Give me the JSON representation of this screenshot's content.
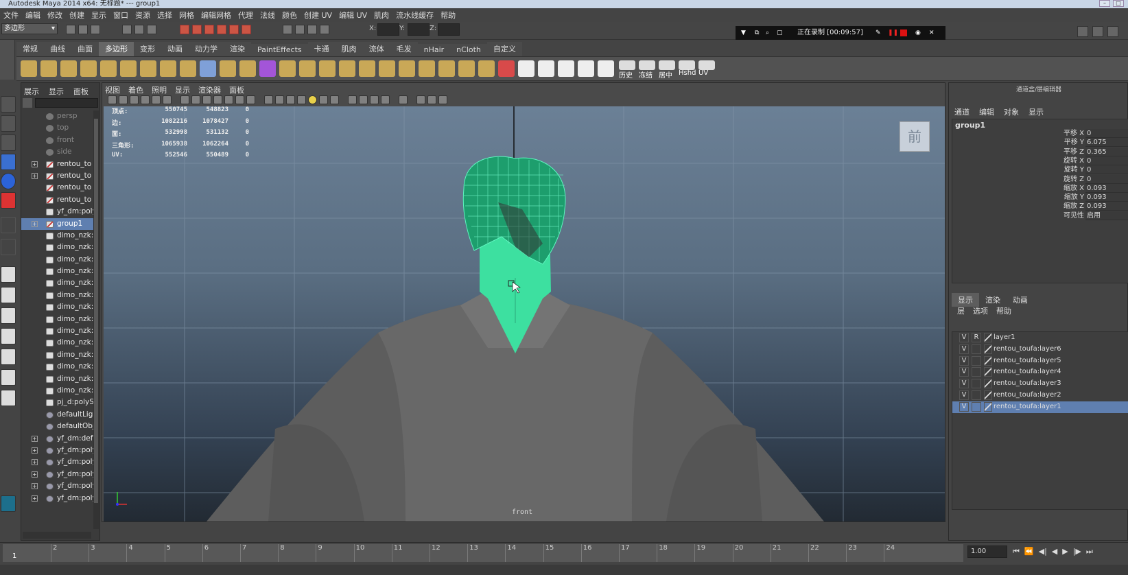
{
  "window": {
    "title": "Autodesk Maya 2014 x64: 无标题*   ---   group1"
  },
  "menubar": [
    "文件",
    "编辑",
    "修改",
    "创建",
    "显示",
    "窗口",
    "资源",
    "选择",
    "网格",
    "编辑网格",
    "代理",
    "法线",
    "颜色",
    "创建 UV",
    "编辑 UV",
    "肌肉",
    "流水线缓存",
    "帮助"
  ],
  "status_line": {
    "mode_select": "多边形",
    "x_label": "X:",
    "y_label": "Y:",
    "z_label": "Z:"
  },
  "recording": {
    "text": "正在录制 [00:09:57]"
  },
  "shelf": {
    "tabs": [
      {
        "label": "常规"
      },
      {
        "label": "曲线"
      },
      {
        "label": "曲面"
      },
      {
        "label": "多边形",
        "active": true
      },
      {
        "label": "变形"
      },
      {
        "label": "动画"
      },
      {
        "label": "动力学"
      },
      {
        "label": "渲染"
      },
      {
        "label": "PaintEffects"
      },
      {
        "label": "卡通"
      },
      {
        "label": "肌肉"
      },
      {
        "label": "流体"
      },
      {
        "label": "毛发"
      },
      {
        "label": "nHair"
      },
      {
        "label": "nCloth"
      },
      {
        "label": "自定义"
      }
    ],
    "text_buttons": [
      "历史",
      "冻结",
      "居中",
      "Hshd",
      "UV"
    ]
  },
  "outliner": {
    "menu": [
      "展示",
      "显示",
      "面板"
    ],
    "items": [
      {
        "label": "persp",
        "type": "cam",
        "dim": true
      },
      {
        "label": "top",
        "type": "cam",
        "dim": true
      },
      {
        "label": "front",
        "type": "cam",
        "dim": true
      },
      {
        "label": "side",
        "type": "cam",
        "dim": true
      },
      {
        "label": "rentou_to",
        "type": "grp",
        "expand": true
      },
      {
        "label": "rentou_to",
        "type": "grp",
        "expand": true
      },
      {
        "label": "rentou_to",
        "type": "grp"
      },
      {
        "label": "rentou_to",
        "type": "grp"
      },
      {
        "label": "yf_dm:poly",
        "type": "mesh"
      },
      {
        "label": "group1",
        "type": "grp",
        "expand": true,
        "selected": true
      },
      {
        "label": "dimo_nzk:",
        "type": "mesh"
      },
      {
        "label": "dimo_nzk:",
        "type": "mesh"
      },
      {
        "label": "dimo_nzk:",
        "type": "mesh"
      },
      {
        "label": "dimo_nzk:",
        "type": "mesh"
      },
      {
        "label": "dimo_nzk:",
        "type": "mesh"
      },
      {
        "label": "dimo_nzk:",
        "type": "mesh"
      },
      {
        "label": "dimo_nzk:",
        "type": "mesh"
      },
      {
        "label": "dimo_nzk:",
        "type": "mesh"
      },
      {
        "label": "dimo_nzk:",
        "type": "mesh"
      },
      {
        "label": "dimo_nzk:",
        "type": "mesh"
      },
      {
        "label": "dimo_nzk:",
        "type": "mesh"
      },
      {
        "label": "dimo_nzk:",
        "type": "mesh"
      },
      {
        "label": "dimo_nzk:",
        "type": "mesh"
      },
      {
        "label": "dimo_nzk:",
        "type": "mesh"
      },
      {
        "label": "pj_d:polyS",
        "type": "mesh"
      },
      {
        "label": "defaultLigh",
        "type": "sph"
      },
      {
        "label": "defaultObj",
        "type": "sph"
      },
      {
        "label": "yf_dm:def",
        "type": "sph",
        "expand": true
      },
      {
        "label": "yf_dm:poly",
        "type": "sph",
        "expand": true
      },
      {
        "label": "yf_dm:poly",
        "type": "sph",
        "expand": true
      },
      {
        "label": "yf_dm:poly",
        "type": "sph",
        "expand": true
      },
      {
        "label": "yf_dm:poly",
        "type": "sph",
        "expand": true
      },
      {
        "label": "yf_dm:poly",
        "type": "sph",
        "expand": true
      }
    ]
  },
  "viewport": {
    "menu": [
      "视图",
      "着色",
      "照明",
      "显示",
      "渲染器",
      "面板"
    ],
    "hud": [
      [
        "顶点:",
        "550745",
        "548823",
        "0"
      ],
      [
        "边:",
        "1082216",
        "1078427",
        "0"
      ],
      [
        "面:",
        "532998",
        "531132",
        "0"
      ],
      [
        "三角形:",
        "1065938",
        "1062264",
        "0"
      ],
      [
        "UV:",
        "552546",
        "550489",
        "0"
      ]
    ],
    "viewcube_label": "前",
    "camera_label": "front"
  },
  "channel_box": {
    "title": "通道盒/层编辑器",
    "menu": [
      "通道",
      "编辑",
      "对象",
      "显示"
    ],
    "object": "group1",
    "channels": [
      {
        "name": "平移 X",
        "value": "0"
      },
      {
        "name": "平移 Y",
        "value": "6.075"
      },
      {
        "name": "平移 Z",
        "value": "0.365"
      },
      {
        "name": "旋转 X",
        "value": "0"
      },
      {
        "name": "旋转 Y",
        "value": "0"
      },
      {
        "name": "旋转 Z",
        "value": "0"
      },
      {
        "name": "缩放 X",
        "value": "0.093"
      },
      {
        "name": "缩放 Y",
        "value": "0.093"
      },
      {
        "name": "缩放 Z",
        "value": "0.093"
      },
      {
        "name": "可见性",
        "value": "启用"
      }
    ]
  },
  "layer_editor": {
    "tabs": [
      {
        "label": "显示",
        "active": true
      },
      {
        "label": "渲染"
      },
      {
        "label": "动画"
      }
    ],
    "menu": [
      "层",
      "选项",
      "帮助"
    ],
    "layers": [
      {
        "v": "V",
        "r": "R",
        "name": "layer1"
      },
      {
        "v": "V",
        "r": "",
        "name": "rentou_toufa:layer6"
      },
      {
        "v": "V",
        "r": "",
        "name": "rentou_toufa:layer5"
      },
      {
        "v": "V",
        "r": "",
        "name": "rentou_toufa:layer4"
      },
      {
        "v": "V",
        "r": "",
        "name": "rentou_toufa:layer3"
      },
      {
        "v": "V",
        "r": "",
        "name": "rentou_toufa:layer2"
      },
      {
        "v": "V",
        "r": "",
        "name": "rentou_toufa:layer1",
        "selected": true
      }
    ]
  },
  "timeline": {
    "ticks": [
      "2",
      "3",
      "4",
      "5",
      "6",
      "7",
      "8",
      "9",
      "10",
      "11",
      "12",
      "13",
      "14",
      "15",
      "16",
      "17",
      "18",
      "19",
      "20",
      "21",
      "22",
      "23",
      "24"
    ],
    "current_frame": "1",
    "end_field": "1.00"
  },
  "colors": {
    "selection_green": "#3de0a0",
    "selected_row": "#5f7fb0"
  }
}
